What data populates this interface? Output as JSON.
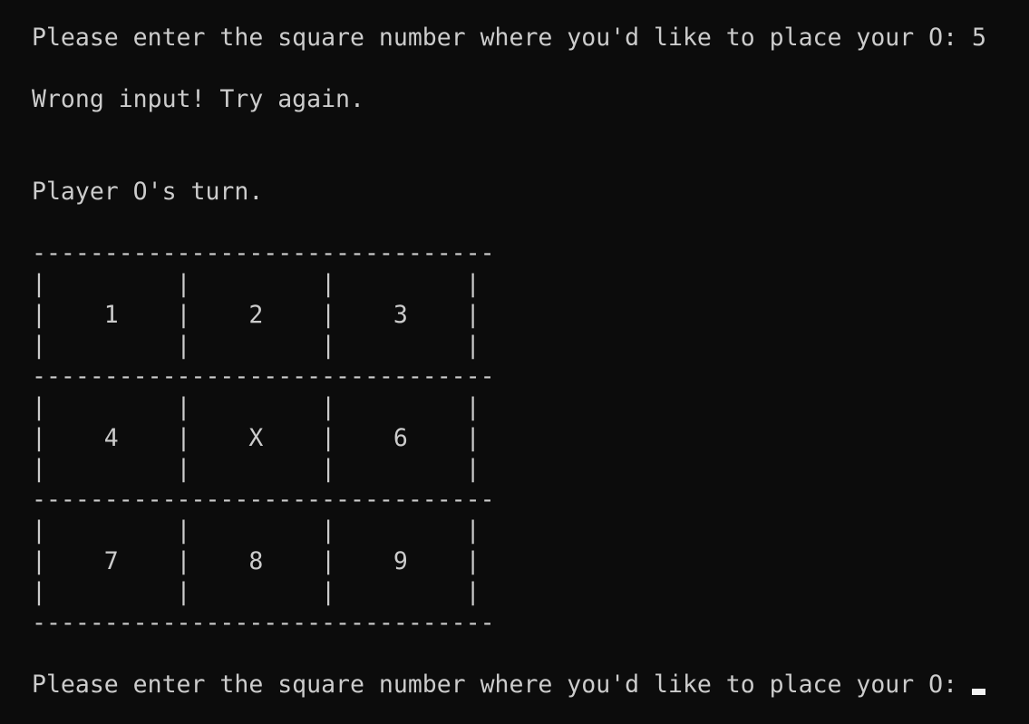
{
  "terminal": {
    "prompt_previous": "Please enter the square number where you'd like to place your O: 5",
    "error_message": "Wrong input! Try again.",
    "turn_message": "Player O's turn.",
    "board_lines": [
      "--------------------------------",
      "|         |         |         |",
      "|    1    |    2    |    3    |",
      "|         |         |         |",
      "--------------------------------",
      "|         |         |         |",
      "|    4    |    X    |    6    |",
      "|         |         |         |",
      "--------------------------------",
      "|         |         |         |",
      "|    7    |    8    |    9    |",
      "|         |         |         |",
      "--------------------------------"
    ],
    "prompt_current": "Please enter the square number where you'd like to place your O:"
  }
}
